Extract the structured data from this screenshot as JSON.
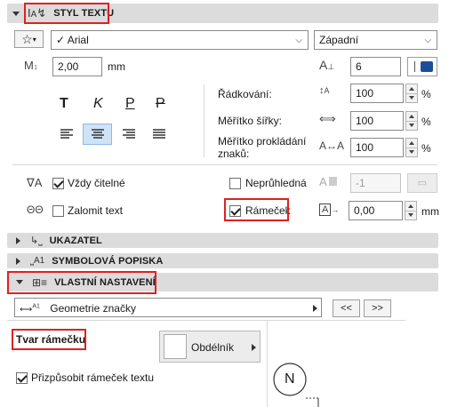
{
  "sections": {
    "styl_textu": "STYL TEXTU",
    "ukazatel": "UKAZATEL",
    "symbolova_popiska": "SYMBOLOVÁ POPISKA",
    "vlastni_nastaveni": "VLASTNÍ NASTAVENÍ"
  },
  "font": {
    "family": "Arial",
    "script": "Západní"
  },
  "size": {
    "value": "2,00",
    "unit": "mm"
  },
  "pen": {
    "value": "6",
    "color": "#1f4e99"
  },
  "style_buttons": [
    "T",
    "K",
    "P",
    "P"
  ],
  "spacing": {
    "line_label": "Řádkování:",
    "line_value": "100",
    "width_label": "Měřítko šířky:",
    "width_value": "100",
    "char_label_1": "Měřítko prokládání",
    "char_label_2": "znaků:",
    "char_value": "100",
    "percent": "%"
  },
  "options": {
    "always_readable": "Vždy čitelné",
    "wrap_text": "Zalomit text",
    "opaque": "Neprůhledná",
    "opaque_pen": "-1",
    "frame": "Rámeček",
    "frame_offset": "0,00",
    "frame_unit": "mm"
  },
  "custom": {
    "geometry": "Geometrie značky",
    "prev": "<<",
    "next": ">>",
    "frame_shape_label": "Tvar rámečku",
    "frame_shape_value": "Obdélník",
    "fit_frame": "Přizpůsobit rámeček textu",
    "marker_letter": "N"
  },
  "colors": {
    "highlight": "#e02020",
    "section_bg": "#dcdcdc",
    "selected_align": "#cfe3f7"
  }
}
